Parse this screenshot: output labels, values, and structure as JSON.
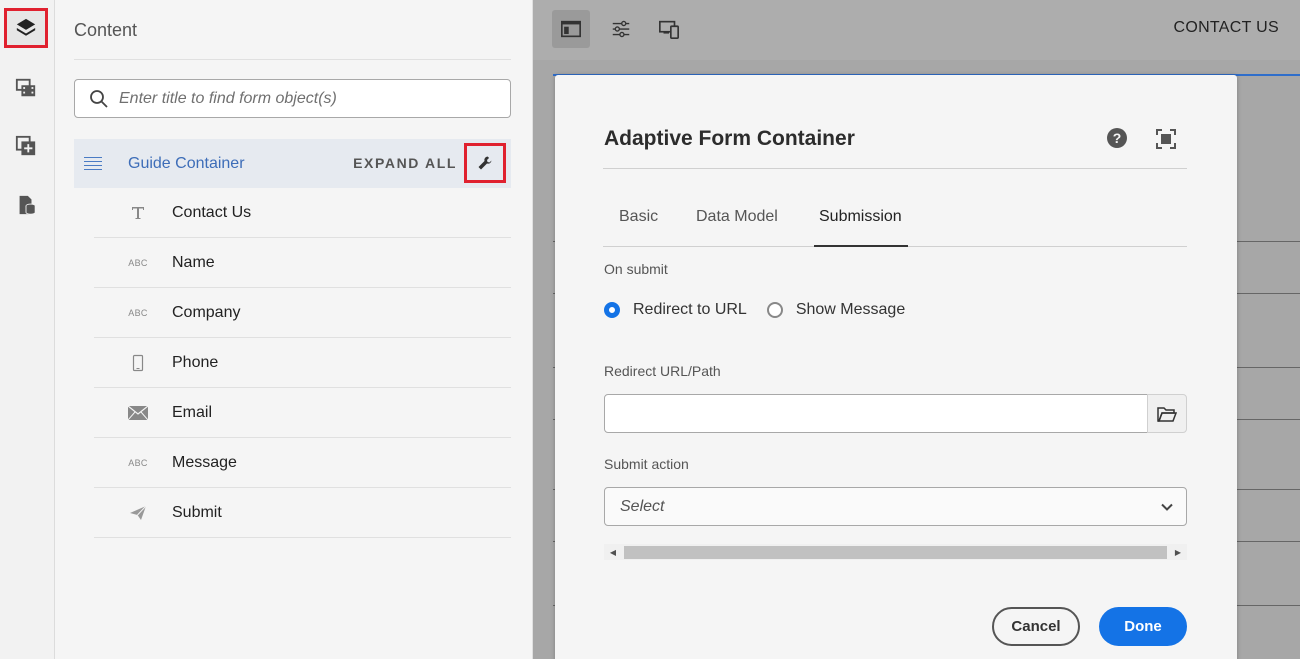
{
  "rail": {
    "items": [
      {
        "name": "layers-icon",
        "active": true
      },
      {
        "name": "assets-icon",
        "active": false
      },
      {
        "name": "add-component-icon",
        "active": false
      },
      {
        "name": "data-sources-icon",
        "active": false
      }
    ]
  },
  "panel": {
    "title": "Content",
    "search_placeholder": "Enter title to find form object(s)",
    "guide_container": "Guide Container",
    "expand_all": "EXPAND ALL",
    "items": [
      {
        "label": "Contact Us",
        "icon": "text-icon"
      },
      {
        "label": "Name",
        "icon": "abc-icon"
      },
      {
        "label": "Company",
        "icon": "abc-icon"
      },
      {
        "label": "Phone",
        "icon": "phone-icon"
      },
      {
        "label": "Email",
        "icon": "email-icon"
      },
      {
        "label": "Message",
        "icon": "abc-icon"
      },
      {
        "label": "Submit",
        "icon": "send-icon"
      }
    ],
    "abc_text": "ABC"
  },
  "topbar": {
    "page_label": "CONTACT US"
  },
  "dialog": {
    "title": "Adaptive Form Container",
    "tabs": [
      "Basic",
      "Data Model",
      "Submission"
    ],
    "active_tab": "Submission",
    "on_submit_label": "On submit",
    "radio_options": [
      "Redirect to URL",
      "Show Message"
    ],
    "radio_selected": "Redirect to URL",
    "redirect_label": "Redirect URL/Path",
    "redirect_value": "",
    "submit_action_label": "Submit action",
    "submit_action_value": "Select",
    "cancel_label": "Cancel",
    "done_label": "Done"
  },
  "colors": {
    "accent": "#1473e6",
    "highlight": "#e0212f",
    "guide_text": "#3d6db8"
  }
}
